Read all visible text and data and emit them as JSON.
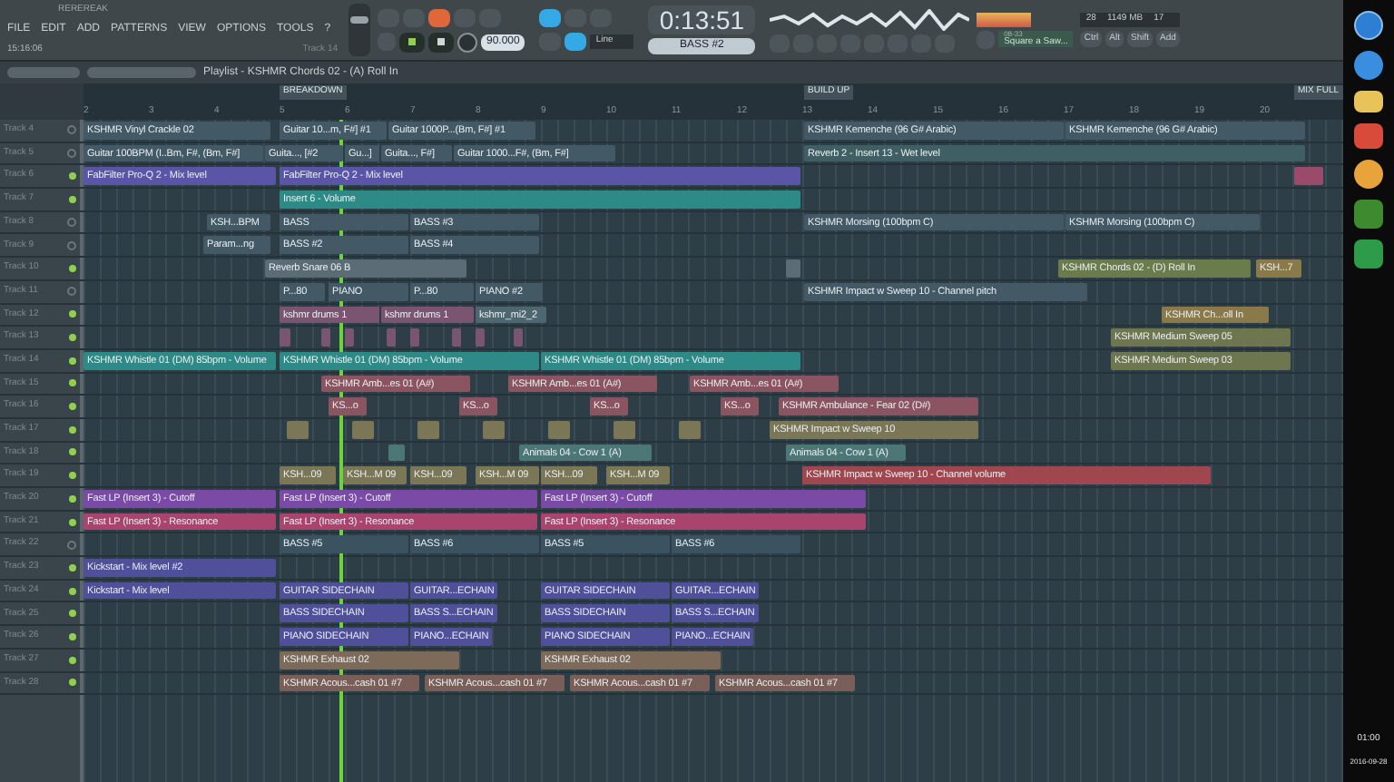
{
  "toolbar": {
    "title": "REREREAK",
    "menu": [
      "FILE",
      "EDIT",
      "ADD",
      "PATTERNS",
      "VIEW",
      "OPTIONS",
      "TOOLS",
      "?"
    ],
    "hint_time": "15:16:06",
    "hint_text": "Track 14",
    "tempo": "90.000",
    "time": "0:13:51",
    "pattern": "BASS #2",
    "input": "Line",
    "cpu": "28",
    "memory": "1149 MB",
    "voices": "17",
    "preset_number": "08-33",
    "preset_name": "Square a Saw...",
    "keys": [
      "Ctrl",
      "Alt",
      "Shift"
    ],
    "add": "Add",
    "master_volume": {
      "level": 0.75
    }
  },
  "playlist": {
    "title": "Playlist - KSHMR Chords 02 - (A) Roll In",
    "ruler": [
      "2",
      "3",
      "4",
      "5",
      "6",
      "7",
      "8",
      "9",
      "10",
      "11",
      "12",
      "13",
      "14",
      "15",
      "16",
      "17",
      "18",
      "19",
      "20"
    ],
    "markers": [
      "BREAKDOWN",
      "BUILD UP",
      "MIX FULL"
    ],
    "tracks": [
      {
        "name": "Track 4",
        "enabled": false,
        "clips": [
          {
            "label": "KSHMR Vinyl Crackle 02",
            "color": "#435a66"
          },
          {
            "label": "Guitar 10...m, F#] #1",
            "color": "#435a66"
          },
          {
            "label": "Guitar 1000P...(Bm, F#] #1",
            "color": "#435a66"
          },
          {
            "label": "KSHMR Kemenche (96 G# Arabic)",
            "color": "#435a66"
          },
          {
            "label": "KSHMR Kemenche (96 G# Arabic)",
            "color": "#435a66"
          }
        ]
      },
      {
        "name": "Track 5",
        "enabled": false,
        "clips": [
          {
            "label": "Guitar 100BPM (I..Bm, F#, (Bm, F#]",
            "color": "#435a66"
          },
          {
            "label": "Guita..., [#2",
            "color": "#435a66"
          },
          {
            "label": "Gu...]",
            "color": "#435a66"
          },
          {
            "label": "Guita..., F#]",
            "color": "#435a66"
          },
          {
            "label": "Guitar 1000...F#, (Bm, F#]",
            "color": "#435a66"
          },
          {
            "label": "Reverb 2 - Insert 13 - Wet level",
            "color": "#3f5f64"
          }
        ]
      },
      {
        "name": "Track 6",
        "enabled": true,
        "clips": [
          {
            "label": "FabFilter Pro-Q 2 - Mix level",
            "color": "#5a55a6"
          },
          {
            "label": "FabFilter Pro-Q 2 - Mix level",
            "color": "#5a55a6"
          },
          {
            "color": "#9a4a6a"
          }
        ]
      },
      {
        "name": "Track 7",
        "enabled": true,
        "clips": [
          {
            "label": "Insert 6 - Volume",
            "color": "#2e8a86"
          }
        ]
      },
      {
        "name": "Track 8",
        "enabled": false,
        "clips": [
          {
            "label": "KSH...BPM",
            "color": "#435a66"
          },
          {
            "label": "BASS",
            "color": "#435a66"
          },
          {
            "label": "BASS #3",
            "color": "#435a66"
          },
          {
            "label": "KSHMR Morsing (100bpm C)",
            "color": "#435a66"
          },
          {
            "label": "KSHMR Morsing (100bpm C)",
            "color": "#435a66"
          }
        ]
      },
      {
        "name": "Track 9",
        "enabled": false,
        "clips": [
          {
            "label": "Param...ng",
            "color": "#435a66"
          },
          {
            "label": "BASS #2",
            "color": "#435a66"
          },
          {
            "label": "BASS #4",
            "color": "#435a66"
          }
        ]
      },
      {
        "name": "Track 10",
        "enabled": true,
        "clips": [
          {
            "label": "Reverb Snare 06 B",
            "color": "#5b6c76"
          },
          {
            "color": "#5b6c76"
          },
          {
            "label": "KSHMR Chords 02 - (D) Roll In",
            "color": "#6a7b4c"
          },
          {
            "label": "KSH...7",
            "color": "#8a7a4a"
          }
        ]
      },
      {
        "name": "Track 11",
        "enabled": false,
        "clips": [
          {
            "label": "P...80",
            "color": "#435a66"
          },
          {
            "label": "PIANO",
            "color": "#435a66"
          },
          {
            "label": "P...80",
            "color": "#435a66"
          },
          {
            "label": "PIANO #2",
            "color": "#435a66"
          },
          {
            "label": "KSHMR Impact w Sweep 10 - Channel pitch",
            "color": "#435a66"
          }
        ]
      },
      {
        "name": "Track 12",
        "enabled": true,
        "clips": [
          {
            "label": "kshmr drums 1",
            "color": "#7a5572"
          },
          {
            "label": "kshmr drums 1",
            "color": "#7a5572"
          },
          {
            "label": "kshmr_mi2_2",
            "color": "#4d6670"
          },
          {
            "label": "KSHMR Ch...oll In",
            "color": "#8a7a4a"
          }
        ]
      },
      {
        "name": "Track 13",
        "enabled": true,
        "clips": [
          {
            "color": "#7a5572"
          },
          {
            "color": "#7a5572"
          },
          {
            "color": "#7a5572"
          },
          {
            "color": "#7a5572"
          },
          {
            "color": "#7a5572"
          },
          {
            "color": "#7a5572"
          },
          {
            "color": "#7a5572"
          },
          {
            "color": "#7a5572"
          },
          {
            "label": "KSHMR Medium Sweep 05",
            "color": "#6e7650"
          }
        ]
      },
      {
        "name": "Track 14",
        "enabled": true,
        "clips": [
          {
            "label": "KSHMR Whistle 01 (DM) 85bpm - Volume",
            "color": "#2e8a86"
          },
          {
            "label": "KSHMR Whistle 01 (DM) 85bpm - Volume",
            "color": "#2e8a86"
          },
          {
            "label": "KSHMR Whistle 01 (DM) 85bpm - Volume",
            "color": "#2e8a86"
          },
          {
            "label": "KSHMR Medium Sweep 03",
            "color": "#6e7650"
          }
        ]
      },
      {
        "name": "Track 15",
        "enabled": true,
        "clips": [
          {
            "label": "KSHMR Amb...es 01 (A#)",
            "color": "#8a5560"
          },
          {
            "label": "KSHMR Amb...es 01 (A#)",
            "color": "#8a5560"
          },
          {
            "label": "KSHMR Amb...es 01 (A#)",
            "color": "#8a5560"
          }
        ]
      },
      {
        "name": "Track 16",
        "enabled": true,
        "clips": [
          {
            "label": "KS...o",
            "color": "#8a5560"
          },
          {
            "label": "KS...o",
            "color": "#8a5560"
          },
          {
            "label": "KS...o",
            "color": "#8a5560"
          },
          {
            "label": "KS...o",
            "color": "#8a5560"
          },
          {
            "label": "KSHMR Ambulance - Fear 02 (D#)",
            "color": "#8a5560"
          }
        ]
      },
      {
        "name": "Track 17",
        "enabled": true,
        "clips": [
          {
            "color": "#7a7656"
          },
          {
            "color": "#7a7656"
          },
          {
            "color": "#7a7656"
          },
          {
            "color": "#7a7656"
          },
          {
            "color": "#7a7656"
          },
          {
            "color": "#7a7656"
          },
          {
            "color": "#7a7656"
          },
          {
            "label": "KSHMR Impact w Sweep 10",
            "color": "#7a7656"
          }
        ]
      },
      {
        "name": "Track 18",
        "enabled": true,
        "clips": [
          {
            "color": "#4b7776"
          },
          {
            "label": "Animals 04 - Cow 1 (A)",
            "color": "#4b7776"
          },
          {
            "label": "Animals 04 - Cow 1 (A)",
            "color": "#4b7776"
          }
        ]
      },
      {
        "name": "Track 19",
        "enabled": true,
        "clips": [
          {
            "label": "KSH...09",
            "color": "#7a7656"
          },
          {
            "label": "KSH...M 09",
            "color": "#7a7656"
          },
          {
            "label": "KSH...09",
            "color": "#7a7656"
          },
          {
            "label": "KSH...M 09",
            "color": "#7a7656"
          },
          {
            "label": "KSH...09",
            "color": "#7a7656"
          },
          {
            "label": "KSH...M 09",
            "color": "#7a7656"
          },
          {
            "label": "KSHMR Impact w Sweep 10 - Channel volume",
            "color": "#a0464e"
          }
        ]
      },
      {
        "name": "Track 20",
        "enabled": true,
        "clips": [
          {
            "label": "Fast LP (Insert 3) - Cutoff",
            "color": "#7a4aa6"
          },
          {
            "label": "Fast LP (Insert 3) - Cutoff",
            "color": "#7a4aa6"
          },
          {
            "label": "Fast LP (Insert 3) - Cutoff",
            "color": "#7a4aa6"
          }
        ]
      },
      {
        "name": "Track 21",
        "enabled": true,
        "clips": [
          {
            "label": "Fast LP (Insert 3) - Resonance",
            "color": "#a8446e"
          },
          {
            "label": "Fast LP (Insert 3) - Resonance",
            "color": "#a8446e"
          },
          {
            "label": "Fast LP (Insert 3) - Resonance",
            "color": "#a8446e"
          }
        ]
      },
      {
        "name": "Track 22",
        "enabled": false,
        "clips": [
          {
            "label": "BASS #5",
            "color": "#3b5260"
          },
          {
            "label": "BASS #6",
            "color": "#3b5260"
          },
          {
            "label": "BASS #5",
            "color": "#3b5260"
          },
          {
            "label": "BASS #6",
            "color": "#3b5260"
          }
        ]
      },
      {
        "name": "Track 23",
        "enabled": true,
        "clips": [
          {
            "label": "Kickstart - Mix level #2",
            "color": "#4f4f9a"
          }
        ]
      },
      {
        "name": "Track 24",
        "enabled": true,
        "clips": [
          {
            "label": "Kickstart - Mix level",
            "color": "#4f4f9a"
          },
          {
            "label": "GUITAR SIDECHAIN",
            "color": "#4f4f9a"
          },
          {
            "label": "GUITAR...ECHAIN",
            "color": "#4f4f9a"
          },
          {
            "label": "GUITAR SIDECHAIN",
            "color": "#4f4f9a"
          },
          {
            "label": "GUITAR...ECHAIN",
            "color": "#4f4f9a"
          }
        ]
      },
      {
        "name": "Track 25",
        "enabled": true,
        "clips": [
          {
            "label": "BASS SIDECHAIN",
            "color": "#4f4f9a"
          },
          {
            "label": "BASS S...ECHAIN",
            "color": "#4f4f9a"
          },
          {
            "label": "BASS SIDECHAIN",
            "color": "#4f4f9a"
          },
          {
            "label": "BASS S...ECHAIN",
            "color": "#4f4f9a"
          }
        ]
      },
      {
        "name": "Track 26",
        "enabled": true,
        "clips": [
          {
            "label": "PIANO SIDECHAIN",
            "color": "#4f4f9a"
          },
          {
            "label": "PIANO...ECHAIN",
            "color": "#4f4f9a"
          },
          {
            "label": "PIANO SIDECHAIN",
            "color": "#4f4f9a"
          },
          {
            "label": "PIANO...ECHAIN",
            "color": "#4f4f9a"
          }
        ]
      },
      {
        "name": "Track 27",
        "enabled": true,
        "clips": [
          {
            "label": "KSHMR Exhaust 02",
            "color": "#7d6a58"
          },
          {
            "label": "KSHMR Exhaust 02",
            "color": "#7d6a58"
          }
        ]
      },
      {
        "name": "Track 28",
        "enabled": true,
        "clips": [
          {
            "label": "KSHMR Acous...cash 01 #7",
            "color": "#7a5e58"
          },
          {
            "label": "KSHMR Acous...cash 01 #7",
            "color": "#7a5e58"
          },
          {
            "label": "KSHMR Acous...cash 01 #7",
            "color": "#7a5e58"
          },
          {
            "label": "KSHMR Acous...cash 01 #7",
            "color": "#7a5e58"
          }
        ]
      }
    ]
  },
  "taskbar": {
    "time": "01:00",
    "date": "2016-09-28"
  }
}
